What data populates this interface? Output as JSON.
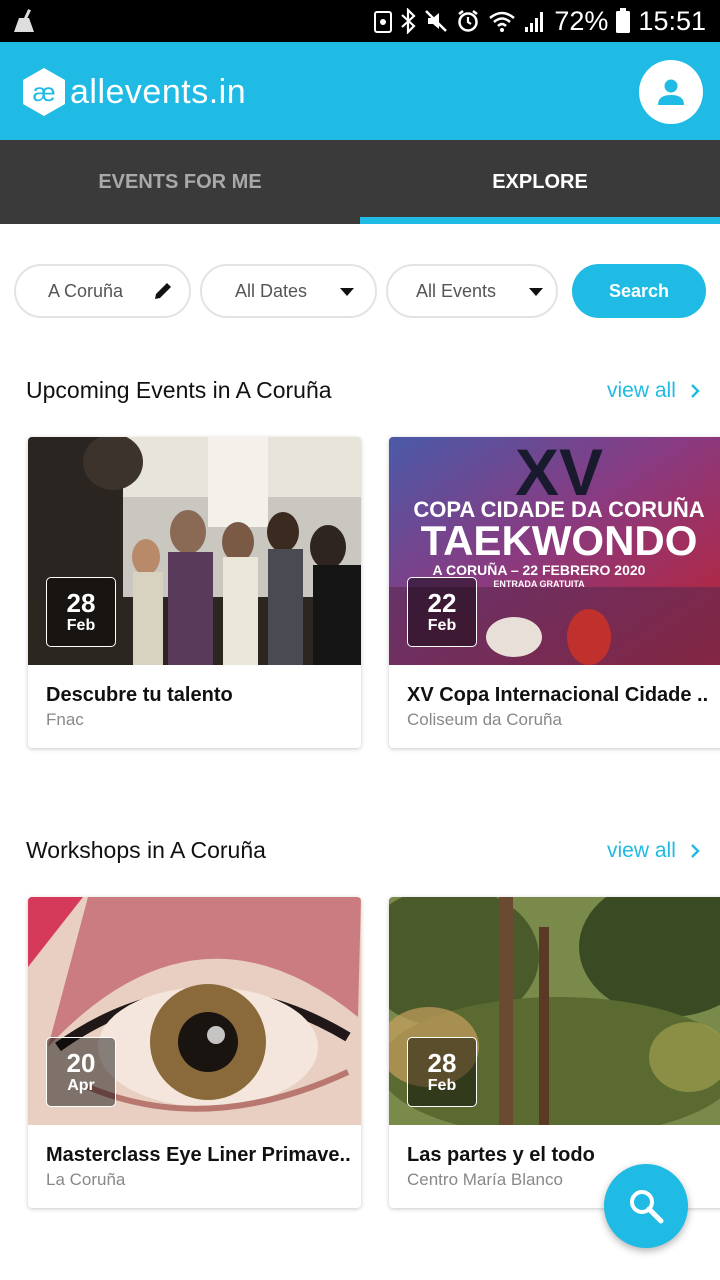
{
  "status_bar": {
    "battery": "72%",
    "time": "15:51"
  },
  "app": {
    "logo_text": "allevents.in",
    "logo_mark": "æ"
  },
  "tabs": [
    {
      "label": "EVENTS FOR ME",
      "active": false
    },
    {
      "label": "EXPLORE",
      "active": true
    }
  ],
  "filters": {
    "location": "A Coruña",
    "dates": "All Dates",
    "events": "All Events",
    "search_label": "Search"
  },
  "sections": [
    {
      "title": "Upcoming Events in A Coruña",
      "view_all": "view all",
      "events": [
        {
          "day": "28",
          "month": "Feb",
          "title": "Descubre tu talento",
          "venue": "Fnac"
        },
        {
          "day": "22",
          "month": "Feb",
          "title": "XV Copa Internacional Cidade ..",
          "venue": "Coliseum da Coruña",
          "poster": {
            "numeral": "XV",
            "line1": "COPA CIDADE DA CORUÑA",
            "line2": "TAEKWONDO",
            "line3": "A CORUÑA – 22 FEBRERO 2020",
            "line4": "ENTRADA GRATUITA"
          }
        }
      ]
    },
    {
      "title": "Workshops in A Coruña",
      "view_all": "view all",
      "events": [
        {
          "day": "20",
          "month": "Apr",
          "title": "Masterclass Eye Liner Primave..",
          "venue": "La Coruña"
        },
        {
          "day": "28",
          "month": "Feb",
          "title": "Las partes y el todo",
          "venue": "Centro María Blanco"
        }
      ]
    }
  ],
  "colors": {
    "brand": "#1fbbe4",
    "tab_bar": "#3a3a3a"
  },
  "icons": [
    "cleaner-icon",
    "nfc-icon",
    "bluetooth-icon",
    "mute-icon",
    "alarm-icon",
    "wifi-icon",
    "signal-icon",
    "battery-icon",
    "user-icon",
    "pencil-icon",
    "chevron-right-icon",
    "search-icon"
  ]
}
